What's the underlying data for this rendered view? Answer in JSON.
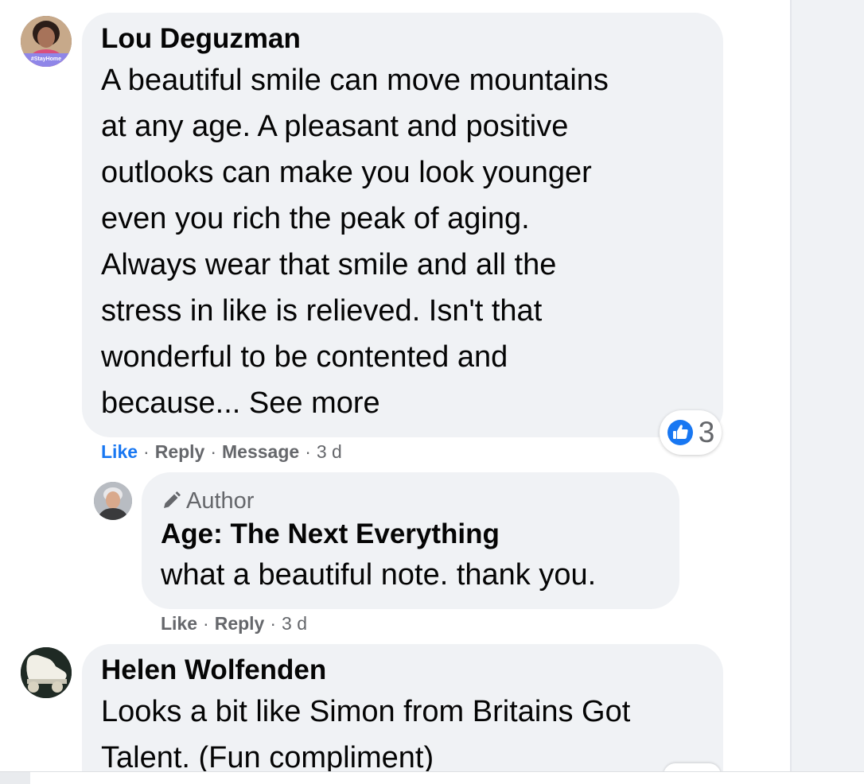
{
  "comments": [
    {
      "author": "Lou Deguzman",
      "avatar_icon": "profile-photo-icon",
      "avatar_badge": "#StayHome",
      "text_lines": [
        "A beautiful smile can move mountains",
        "at any age. A pleasant and positive",
        "outlooks can make you look younger",
        "even you rich the peak of aging.",
        "Always wear that smile and all the",
        "stress in like is relieved. Isn't that",
        "wonderful to be contented and",
        "because..."
      ],
      "see_more": "See more",
      "actions": {
        "like": "Like",
        "reply": "Reply",
        "message": "Message",
        "time": "3 d"
      },
      "reaction": {
        "icon": "like-reaction-icon",
        "count": "3",
        "color": "#1877f2"
      }
    },
    {
      "author": "Age: The Next Everything",
      "badge": "Author",
      "badge_icon": "pencil-icon",
      "avatar_icon": "profile-photo-icon",
      "text": "what a beautiful note. thank you.",
      "actions": {
        "like": "Like",
        "reply": "Reply",
        "time": "3 d"
      }
    },
    {
      "author": "Helen Wolfenden",
      "avatar_icon": "roller-skate-photo-icon",
      "text_lines": [
        "Looks a bit like Simon from Britains Got",
        "Talent. (Fun compliment)"
      ]
    }
  ],
  "colors": {
    "bubble": "#f0f2f5",
    "link_active": "#1877f2",
    "secondary_text": "#65676b",
    "primary_text": "#050505"
  }
}
